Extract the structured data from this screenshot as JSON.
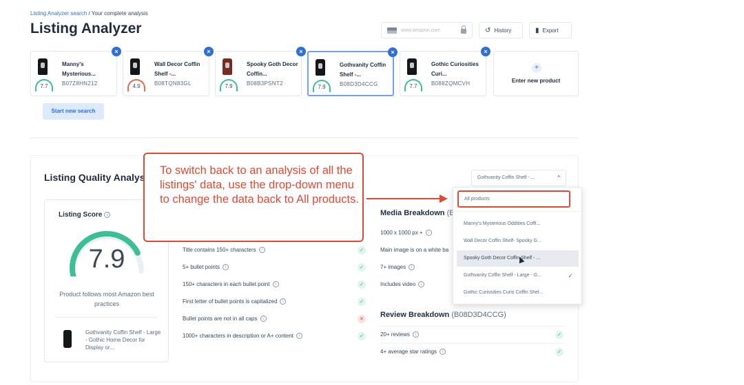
{
  "breadcrumb": {
    "link": "Listing Analyzer search",
    "separator": " / ",
    "current": "Your complete analysis"
  },
  "page": {
    "title": "Listing Analyzer"
  },
  "header": {
    "url_placeholder": "www.amazon.com",
    "history_label": "History",
    "export_label": "Export"
  },
  "products": [
    {
      "name": "Manny's Mysterious...",
      "asin": "B07Z8HN212",
      "score": "7.7"
    },
    {
      "name": "Wall Decor Coffin Shelf -...",
      "asin": "B08TQN83GL",
      "score": "4.9"
    },
    {
      "name": "Spooky Goth Decor Coffin...",
      "asin": "B08B3PSNT2",
      "score": "7.9"
    },
    {
      "name": "Gothvanity Coffin Shelf -...",
      "asin": "B08D3D4CCG",
      "score": "7.9"
    },
    {
      "name": "Gothic Curiosities Curi...",
      "asin": "B088ZQMCVH",
      "score": "7.7"
    }
  ],
  "enter_new_product": "Enter new product",
  "start_new_search": "Start new search",
  "analysis": {
    "title": "Listing Quality Analysis",
    "title_visible": "Listing Quality Analys",
    "score_label": "Listing Score",
    "score_value": "7.9",
    "score_fraction": 0.79,
    "score_desc": "Product follows most Amazon best practices",
    "product_name": "Gothvanity Coffin Shelf - Large - Gothic Home Decor for Display or..."
  },
  "text_checks": [
    {
      "label": "Title contains 150+ characters",
      "pass": true
    },
    {
      "label": "5+ bullet points",
      "pass": true
    },
    {
      "label": "150+ characters in each bullet point",
      "pass": true
    },
    {
      "label": "First letter of bullet points is capitalized",
      "pass": true
    },
    {
      "label": "Bullet points are not in all caps",
      "pass": false
    },
    {
      "label": "1000+ characters in description or A+ content",
      "pass": true
    }
  ],
  "media": {
    "heading": "Media Breakdown",
    "asin": "(B",
    "checks": [
      {
        "label": "1000 x 1000 px +"
      },
      {
        "label": "Main image is on a white ba"
      },
      {
        "label": "7+ images"
      },
      {
        "label": "Includes video"
      }
    ]
  },
  "review": {
    "heading": "Review Breakdown",
    "asin": "(B08D3D4CCG)",
    "checks": [
      {
        "label": "20+ reviews",
        "pass": true
      },
      {
        "label": "4+ average star ratings",
        "pass": true
      }
    ]
  },
  "dropdown": {
    "selected": "Gothvanity Coffin Shelf - ...",
    "options": [
      "All products",
      "Manny's Mysterious Oddities Coffi...",
      "Wall Decor Coffin Shelf- Spooky G...",
      "Spooky Goth Decor Coffin Shelf - ...",
      "Gothvanity Coffin Shelf - Large - G...",
      "Gothic Curiosities Curio Coffin Shel..."
    ]
  },
  "callout_text": "To switch back to an analysis of all the listings' data, use the drop-down menu to change the data back to All products.",
  "icons": [
    "flag-icon",
    "lock-icon",
    "history-icon",
    "export-icon",
    "remove-icon",
    "plus-icon",
    "info-icon",
    "check-icon",
    "cross-icon",
    "chevron-up-icon",
    "checkmark-icon",
    "cursor-icon"
  ],
  "colors": {
    "accent": "#2f6fd6",
    "pass": "#3cbf94",
    "fail": "#e8694a",
    "annotation": "#e04a33"
  }
}
